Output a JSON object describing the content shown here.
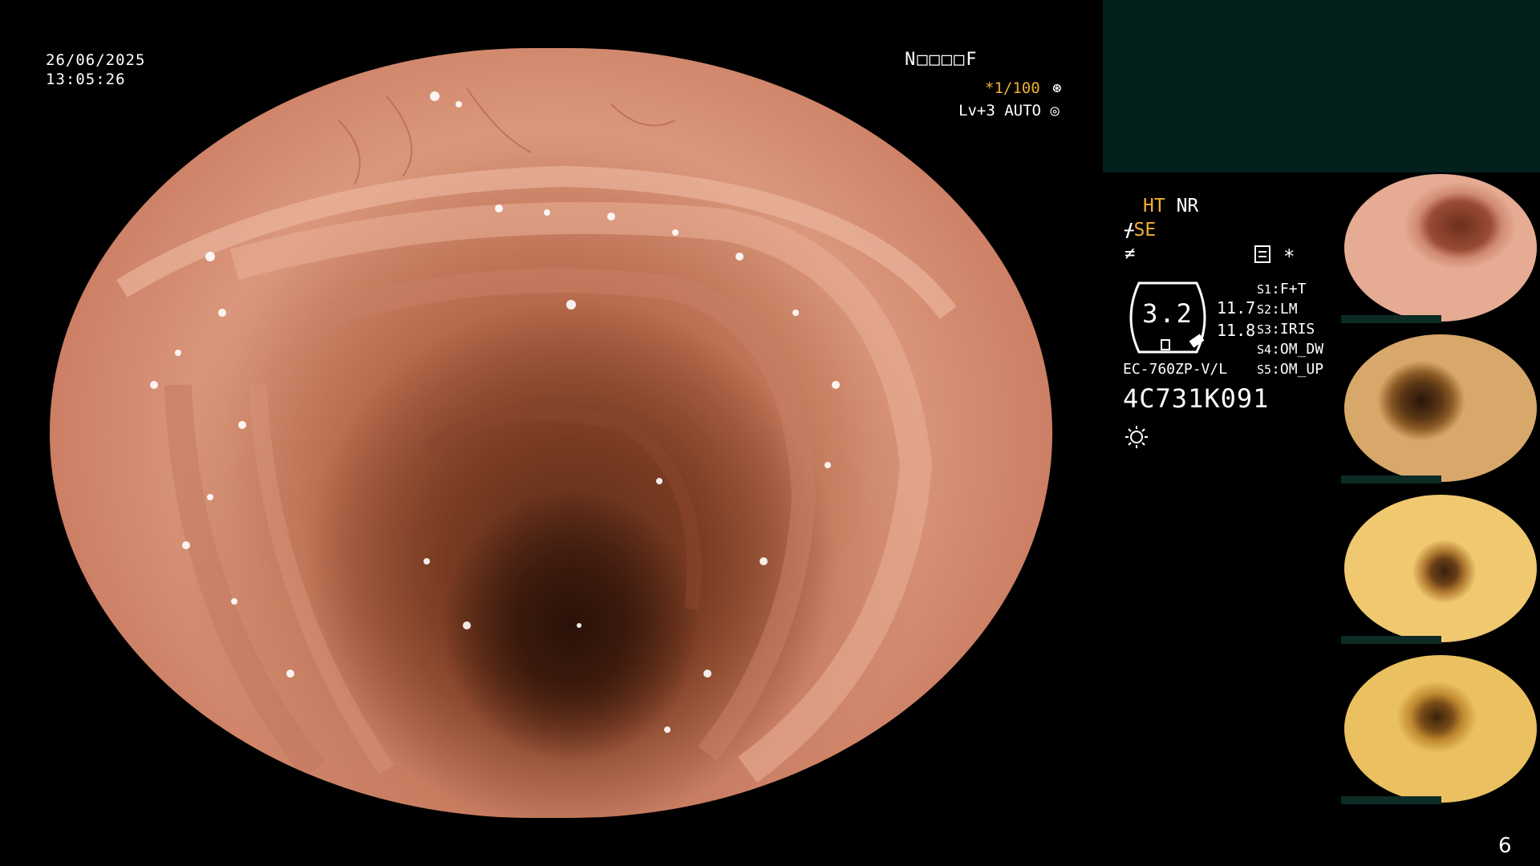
{
  "overlay": {
    "date": "26/06/2025",
    "time": "13:05:26",
    "top_status": "N□□□□F",
    "shutter": "*1/100",
    "shutter_icon": "shutter-icon",
    "iris": "Lv+3 AUTO",
    "iris_icon": "iris-icon"
  },
  "panel": {
    "ht": "HT",
    "nr": "NR",
    "se_icon": "ᚋ",
    "se": "SE",
    "fstop_icon": "≠",
    "asterisk": "*",
    "zoom_value": "3.2",
    "value_a": "11.7",
    "value_b": "11.8",
    "settings": [
      {
        "key": "S1",
        "value": "F+T"
      },
      {
        "key": "S2",
        "value": "LM"
      },
      {
        "key": "S3",
        "value": "IRIS"
      },
      {
        "key": "S4",
        "value": "OM_DW"
      },
      {
        "key": "S5",
        "value": "OM_UP"
      }
    ],
    "scope_model": "EC-760ZP-V/L",
    "serial": "4C731K091",
    "light_icon": "light-source-icon"
  },
  "thumbnails_count": 4,
  "page_number": "6",
  "colors": {
    "accent": "#f0b030",
    "teal_panel": "#03201c",
    "background": "#000000"
  }
}
